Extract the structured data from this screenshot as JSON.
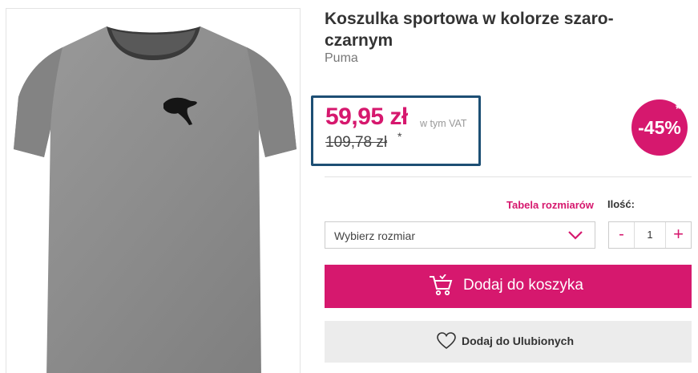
{
  "product": {
    "title": "Koszulka sportowa w kolorze szaro-czarnym",
    "brand": "Puma",
    "image_icon": "tshirt-image"
  },
  "price": {
    "current": "59,95 zł",
    "vat_note": "w tym VAT",
    "old": "109,78 zł",
    "old_star": "*"
  },
  "discount": {
    "label": "-45%",
    "star": "*"
  },
  "size": {
    "table_link": "Tabela rozmiarów",
    "placeholder": "Wybierz rozmiar"
  },
  "quantity": {
    "label": "Ilość:",
    "minus": "-",
    "value": "1",
    "plus": "+"
  },
  "actions": {
    "add_to_cart": "Dodaj do koszyka",
    "add_to_favorites": "Dodaj do Ulubionych"
  },
  "colors": {
    "accent": "#d6186e",
    "price_border": "#1d4f74"
  }
}
